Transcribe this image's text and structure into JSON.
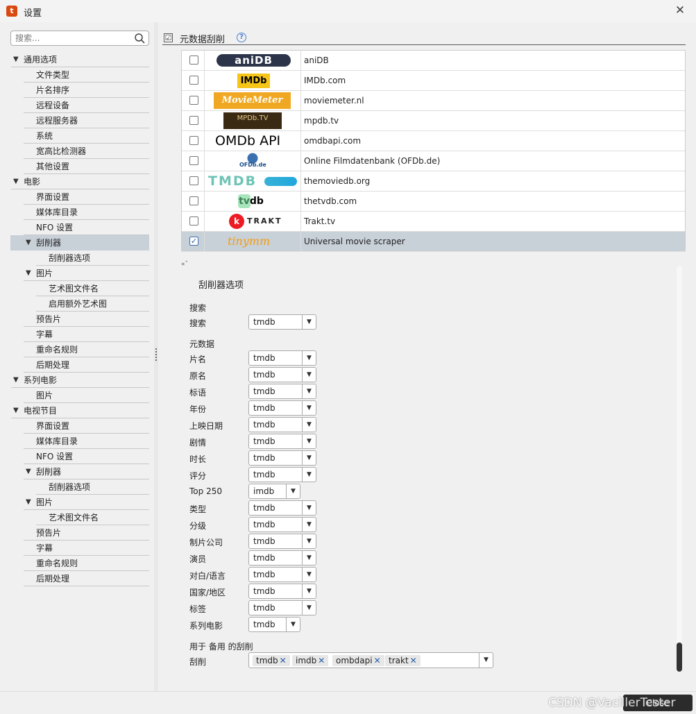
{
  "window": {
    "app_icon": "app-icon",
    "title": "设置",
    "close_glyph": "✕"
  },
  "sidebar": {
    "search_placeholder": "搜索...",
    "tree": [
      {
        "label": "通用选项",
        "level": 0,
        "expanded": true
      },
      {
        "label": "文件类型",
        "level": 1
      },
      {
        "label": "片名排序",
        "level": 1
      },
      {
        "label": "远程设备",
        "level": 1
      },
      {
        "label": "远程服务器",
        "level": 1
      },
      {
        "label": "系统",
        "level": 1
      },
      {
        "label": "宽高比检测器",
        "level": 1
      },
      {
        "label": "其他设置",
        "level": 1
      },
      {
        "label": "电影",
        "level": 0,
        "expanded": true
      },
      {
        "label": "界面设置",
        "level": 1
      },
      {
        "label": "媒体库目录",
        "level": 1
      },
      {
        "label": "NFO 设置",
        "level": 1
      },
      {
        "label": "刮削器",
        "level": 1,
        "expanded": true,
        "selected": true
      },
      {
        "label": "刮削器选项",
        "level": 2
      },
      {
        "label": "图片",
        "level": 1,
        "expanded": true
      },
      {
        "label": "艺术图文件名",
        "level": 2
      },
      {
        "label": "启用额外艺术图",
        "level": 2
      },
      {
        "label": "预告片",
        "level": 1
      },
      {
        "label": "字幕",
        "level": 1
      },
      {
        "label": "重命名规则",
        "level": 1
      },
      {
        "label": "后期处理",
        "level": 1
      },
      {
        "label": "系列电影",
        "level": 0,
        "expanded": true
      },
      {
        "label": "图片",
        "level": 1
      },
      {
        "label": "电视节目",
        "level": 0,
        "expanded": true
      },
      {
        "label": "界面设置",
        "level": 1
      },
      {
        "label": "媒体库目录",
        "level": 1
      },
      {
        "label": "NFO 设置",
        "level": 1
      },
      {
        "label": "刮削器",
        "level": 1,
        "expanded": true
      },
      {
        "label": "刮削器选项",
        "level": 2
      },
      {
        "label": "图片",
        "level": 1,
        "expanded": true
      },
      {
        "label": "艺术图文件名",
        "level": 2
      },
      {
        "label": "预告片",
        "level": 1
      },
      {
        "label": "字幕",
        "level": 1
      },
      {
        "label": "重命名规则",
        "level": 1
      },
      {
        "label": "后期处理",
        "level": 1
      }
    ]
  },
  "main": {
    "header": {
      "title": "元数据刮削",
      "checkbox_glyph": "☑",
      "help_glyph": "?"
    },
    "scrapers": [
      {
        "logo": "aniDB",
        "name": "aniDB",
        "checked": false
      },
      {
        "logo": "IMDb",
        "name": "IMDb.com",
        "checked": false
      },
      {
        "logo": "MovieMeter",
        "name": "moviemeter.nl",
        "checked": false
      },
      {
        "logo": "MPDb.TV",
        "name": "mpdb.tv",
        "checked": false
      },
      {
        "logo": "OMDb API",
        "name": "omdbapi.com",
        "checked": false
      },
      {
        "logo": "OFDb.de",
        "name": "Online Filmdatenbank (OFDb.de)",
        "checked": false
      },
      {
        "logo": "TMDB",
        "name": "themoviedb.org",
        "checked": false
      },
      {
        "logo": "tvdb",
        "name": "thetvdb.com",
        "checked": false
      },
      {
        "logo": "TRAKT",
        "name": "Trakt.tv",
        "checked": false
      },
      {
        "logo": "tinymm",
        "name": "Universal movie scraper",
        "checked": true,
        "selected": true
      }
    ],
    "check_glyph": "✓",
    "collapse_glyph": "«ˇ",
    "options": {
      "title": "刮削器选项",
      "search_section": "搜索",
      "search_label": "搜索",
      "search_value": "tmdb",
      "metadata_section": "元数据",
      "fields": [
        {
          "label": "片名",
          "value": "tmdb"
        },
        {
          "label": "原名",
          "value": "tmdb"
        },
        {
          "label": "标语",
          "value": "tmdb"
        },
        {
          "label": "年份",
          "value": "tmdb"
        },
        {
          "label": "上映日期",
          "value": "tmdb"
        },
        {
          "label": "剧情",
          "value": "tmdb"
        },
        {
          "label": "时长",
          "value": "tmdb"
        },
        {
          "label": "评分",
          "value": "tmdb"
        },
        {
          "label": "Top 250",
          "value": "imdb",
          "narrow": true
        },
        {
          "label": "类型",
          "value": "tmdb"
        },
        {
          "label": "分级",
          "value": "tmdb"
        },
        {
          "label": "制片公司",
          "value": "tmdb"
        },
        {
          "label": "演员",
          "value": "tmdb"
        },
        {
          "label": "对白/语言",
          "value": "tmdb"
        },
        {
          "label": "国家/地区",
          "value": "tmdb"
        },
        {
          "label": "标签",
          "value": "tmdb"
        },
        {
          "label": "系列电影",
          "value": "tmdb",
          "narrow": true
        }
      ],
      "fallback_section": "用于 备用 的刮削",
      "fallback_label": "刮削",
      "fallback_tags": [
        "tmdb",
        "imdb",
        "ombdapi",
        "trakt"
      ],
      "dropdown_glyph": "▼",
      "tag_remove_glyph": "✕"
    }
  },
  "footer": {
    "close_label": "Close"
  },
  "watermark": "CSDN @VacillerTester"
}
